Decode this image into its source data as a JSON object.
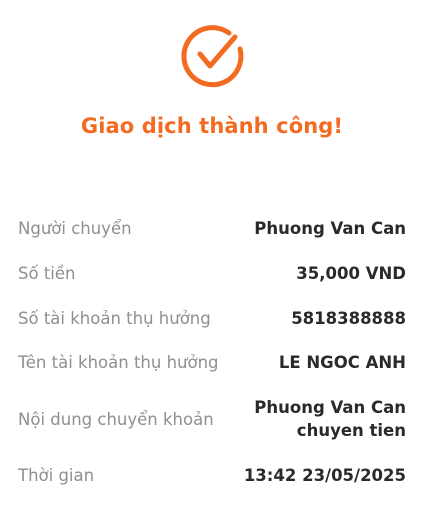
{
  "status": {
    "icon": "check-circle-icon",
    "title": "Giao dịch thành công!",
    "accent_color": "#f26b21"
  },
  "details": {
    "sender": {
      "label": "Người chuyển",
      "value": "Phuong Van Can"
    },
    "amount": {
      "label": "Số tiền",
      "value": "35,000 VND"
    },
    "account_number": {
      "label": "Số tài khoản thụ hưởng",
      "value": "5818388888"
    },
    "account_name": {
      "label": "Tên tài khoản thụ hưởng",
      "value": "LE NGOC ANH"
    },
    "content": {
      "label": "Nội dung chuyển khoản",
      "value_lines": [
        "Phuong Van Can",
        "chuyen tien"
      ]
    },
    "time": {
      "label": "Thời gian",
      "value": "13:42 23/05/2025"
    }
  }
}
